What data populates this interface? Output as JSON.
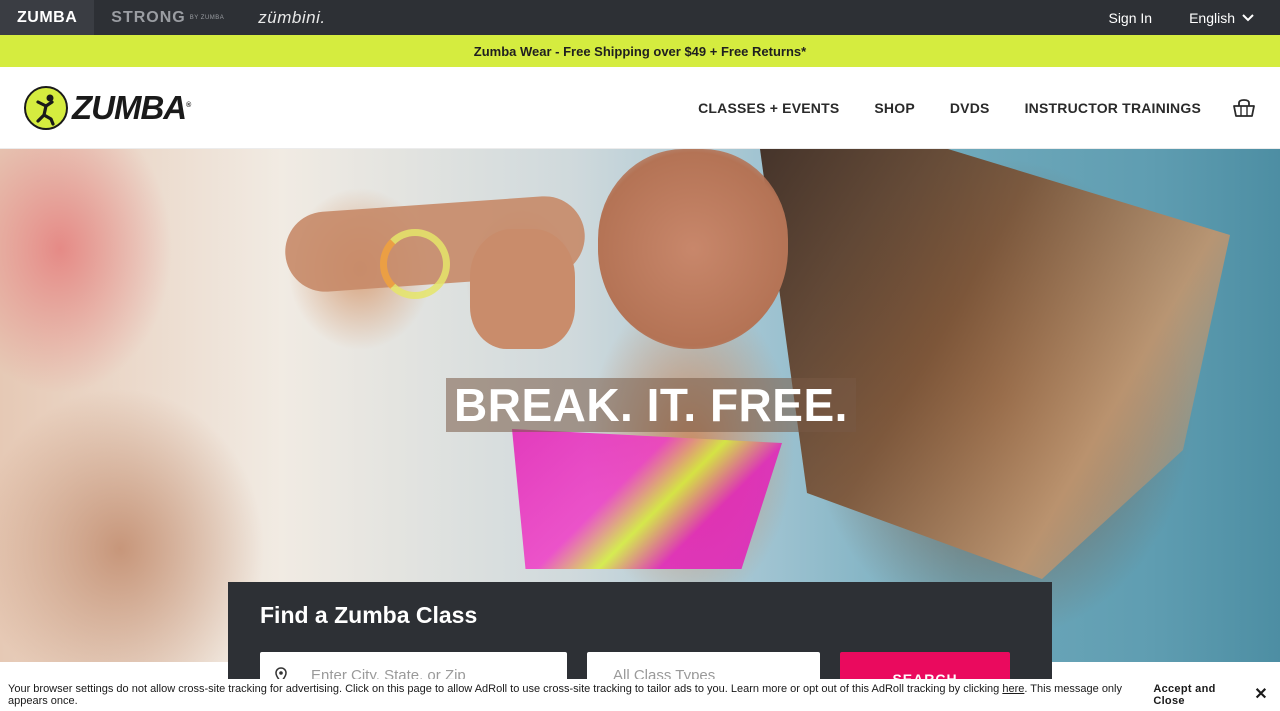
{
  "topbar": {
    "brands": [
      {
        "label": "ZUMBA"
      },
      {
        "label": "STRONG",
        "sub": "BY ZUMBA"
      },
      {
        "label": "zümbini."
      }
    ],
    "sign_in": "Sign In",
    "language": "English"
  },
  "promo": {
    "text": "Zumba Wear - Free Shipping over $49 + Free Returns*"
  },
  "header": {
    "logo_text": "ZUMBA",
    "logo_reg": "®",
    "nav": [
      {
        "label": "CLASSES + EVENTS"
      },
      {
        "label": "SHOP"
      },
      {
        "label": "DVDS"
      },
      {
        "label": "INSTRUCTOR TRAININGS"
      }
    ],
    "cart_icon": "shopping-bag-icon"
  },
  "hero": {
    "headline": "BREAK. IT. FREE."
  },
  "finder": {
    "title": "Find a Zumba Class",
    "location_placeholder": "Enter City, State, or Zip",
    "class_type": "All Class Types",
    "search_label": "SEARCH"
  },
  "cookie": {
    "text_before": "Your browser settings do not allow cross-site tracking for advertising. Click on this page to allow AdRoll to use cross-site tracking to tailor ads to you. Learn more or opt out of this AdRoll tracking by clicking ",
    "link": "here",
    "text_after": ". This message only appears once.",
    "accept": "Accept and Close",
    "close_symbol": "✕"
  },
  "colors": {
    "topbar": "#2d3035",
    "promo": "#d5ec3f",
    "search_button": "#ea0a5e"
  }
}
